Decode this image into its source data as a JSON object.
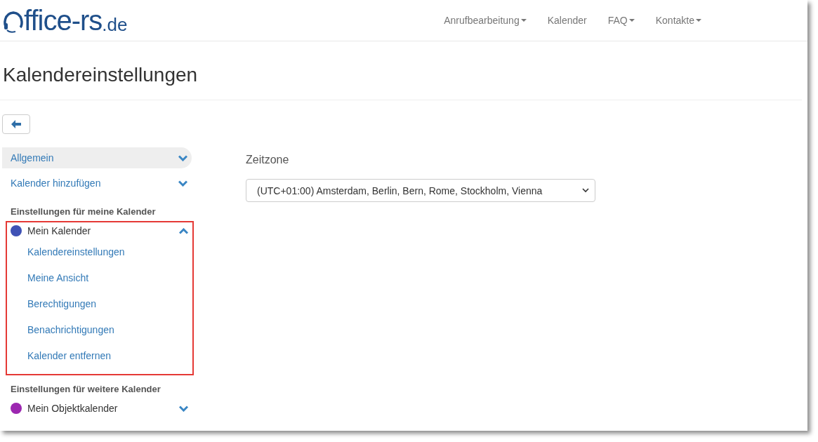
{
  "logo": {
    "name": "ffice-rs",
    "suffix": ".de"
  },
  "nav": [
    {
      "label": "Anrufbearbeitung",
      "dropdown": true
    },
    {
      "label": "Kalender",
      "dropdown": false
    },
    {
      "label": "FAQ",
      "dropdown": true
    },
    {
      "label": "Kontakte",
      "dropdown": true
    }
  ],
  "page_title": "Kalendereinstellungen",
  "sidebar": {
    "items": [
      {
        "label": "Allgemein",
        "selected": true,
        "expanded": false
      },
      {
        "label": "Kalender hinzufügen",
        "selected": false,
        "expanded": false
      }
    ],
    "sections": [
      {
        "heading": "Einstellungen für meine Kalender",
        "calendars": [
          {
            "name": "Mein Kalender",
            "color": "#3f51b5",
            "expanded": true,
            "highlighted": true,
            "children": [
              {
                "label": "Kalendereinstellungen"
              },
              {
                "label": "Meine Ansicht"
              },
              {
                "label": "Berechtigungen"
              },
              {
                "label": "Benachrichtigungen"
              },
              {
                "label": "Kalender entfernen"
              }
            ]
          }
        ]
      },
      {
        "heading": "Einstellungen für weitere Kalender",
        "calendars": [
          {
            "name": "Mein Objektkalender",
            "color": "#9c27b0",
            "expanded": false,
            "highlighted": false
          }
        ]
      }
    ]
  },
  "timezone": {
    "label": "Zeitzone",
    "value": "(UTC+01:00) Amsterdam, Berlin, Bern, Rome, Stockholm, Vienna"
  }
}
